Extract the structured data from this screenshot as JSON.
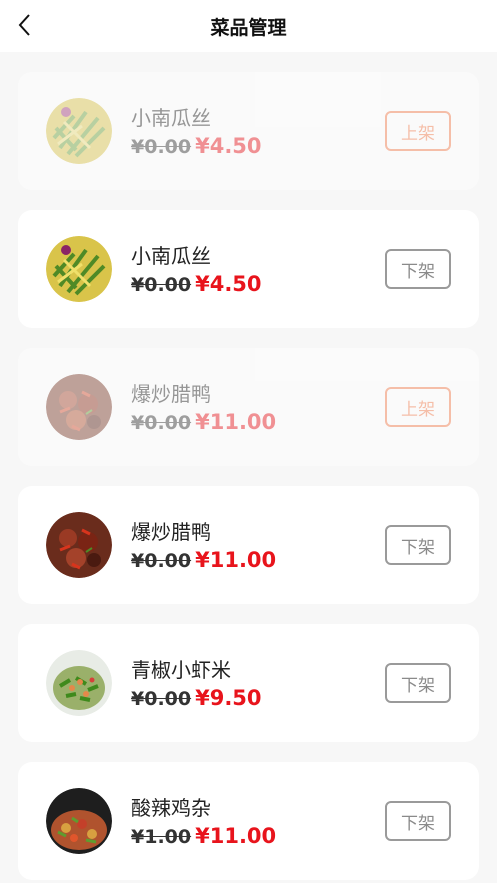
{
  "header": {
    "title": "菜品管理",
    "back_icon": "chevron-left-icon"
  },
  "dishes": [
    {
      "name": "小南瓜丝",
      "old_price": "¥0.00",
      "new_price": "¥4.50",
      "action": "上架",
      "status": "off-shelf",
      "image": "shredded-pumpkin"
    },
    {
      "name": "小南瓜丝",
      "old_price": "¥0.00",
      "new_price": "¥4.50",
      "action": "下架",
      "status": "on-shelf",
      "image": "shredded-pumpkin"
    },
    {
      "name": "爆炒腊鸭",
      "old_price": "¥0.00",
      "new_price": "¥11.00",
      "action": "上架",
      "status": "off-shelf",
      "image": "stir-fried-duck"
    },
    {
      "name": "爆炒腊鸭",
      "old_price": "¥0.00",
      "new_price": "¥11.00",
      "action": "下架",
      "status": "on-shelf",
      "image": "stir-fried-duck"
    },
    {
      "name": "青椒小虾米",
      "old_price": "¥0.00",
      "new_price": "¥9.50",
      "action": "下架",
      "status": "on-shelf",
      "image": "pepper-shrimp"
    },
    {
      "name": "酸辣鸡杂",
      "old_price": "¥1.00",
      "new_price": "¥11.00",
      "action": "下架",
      "status": "on-shelf",
      "image": "spicy-chicken-giblets"
    }
  ],
  "colors": {
    "price": "#e8141c",
    "on_shelf_button": "#f47a4a",
    "off_shelf_button": "#9a9a9a",
    "background": "#f7f7f7"
  }
}
